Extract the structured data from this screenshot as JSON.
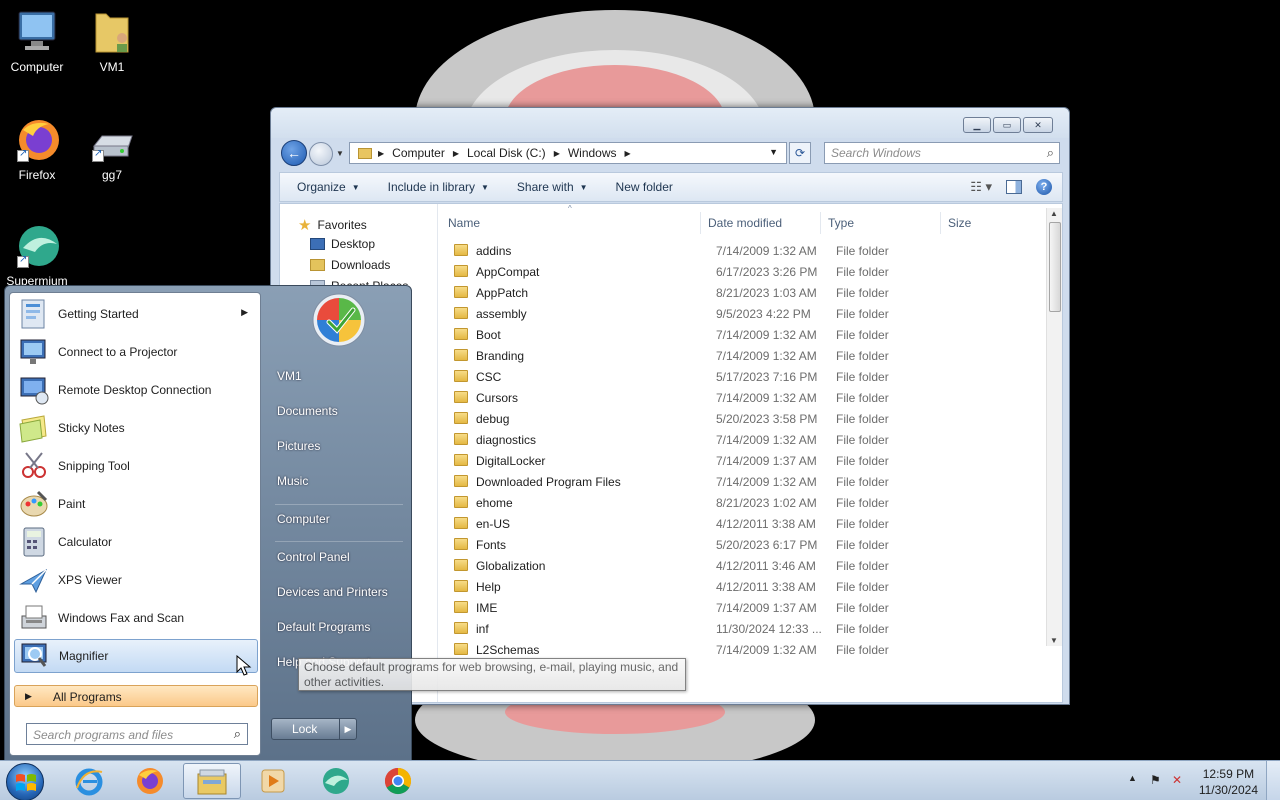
{
  "desktop": {
    "icons": [
      {
        "label": "Computer"
      },
      {
        "label": "VM1"
      },
      {
        "label": "Firefox"
      },
      {
        "label": "gg7"
      },
      {
        "label": "Supermium"
      }
    ]
  },
  "explorer": {
    "breadcrumb": [
      "Computer",
      "Local Disk (C:)",
      "Windows"
    ],
    "search_placeholder": "Search Windows",
    "toolbar": {
      "organize": "Organize",
      "include_in_library": "Include in library",
      "share_with": "Share with",
      "new_folder": "New folder"
    },
    "nav_pane": {
      "favorites": "Favorites",
      "items": [
        "Desktop",
        "Downloads",
        "Recent Places"
      ]
    },
    "columns": {
      "name": "Name",
      "date_modified": "Date modified",
      "type": "Type",
      "size": "Size"
    },
    "files": [
      {
        "name": "addins",
        "date": "7/14/2009 1:32 AM",
        "type": "File folder"
      },
      {
        "name": "AppCompat",
        "date": "6/17/2023 3:26 PM",
        "type": "File folder"
      },
      {
        "name": "AppPatch",
        "date": "8/21/2023 1:03 AM",
        "type": "File folder"
      },
      {
        "name": "assembly",
        "date": "9/5/2023 4:22 PM",
        "type": "File folder"
      },
      {
        "name": "Boot",
        "date": "7/14/2009 1:32 AM",
        "type": "File folder"
      },
      {
        "name": "Branding",
        "date": "7/14/2009 1:32 AM",
        "type": "File folder"
      },
      {
        "name": "CSC",
        "date": "5/17/2023 7:16 PM",
        "type": "File folder"
      },
      {
        "name": "Cursors",
        "date": "7/14/2009 1:32 AM",
        "type": "File folder"
      },
      {
        "name": "debug",
        "date": "5/20/2023 3:58 PM",
        "type": "File folder"
      },
      {
        "name": "diagnostics",
        "date": "7/14/2009 1:32 AM",
        "type": "File folder"
      },
      {
        "name": "DigitalLocker",
        "date": "7/14/2009 1:37 AM",
        "type": "File folder"
      },
      {
        "name": "Downloaded Program Files",
        "date": "7/14/2009 1:32 AM",
        "type": "File folder"
      },
      {
        "name": "ehome",
        "date": "8/21/2023 1:02 AM",
        "type": "File folder"
      },
      {
        "name": "en-US",
        "date": "4/12/2011 3:38 AM",
        "type": "File folder"
      },
      {
        "name": "Fonts",
        "date": "5/20/2023 6:17 PM",
        "type": "File folder"
      },
      {
        "name": "Globalization",
        "date": "4/12/2011 3:46 AM",
        "type": "File folder"
      },
      {
        "name": "Help",
        "date": "4/12/2011 3:38 AM",
        "type": "File folder"
      },
      {
        "name": "IME",
        "date": "7/14/2009 1:37 AM",
        "type": "File folder"
      },
      {
        "name": "inf",
        "date": "11/30/2024 12:33 ...",
        "type": "File folder"
      },
      {
        "name": "L2Schemas",
        "date": "7/14/2009 1:32 AM",
        "type": "File folder"
      }
    ]
  },
  "start_menu": {
    "programs": [
      {
        "label": "Getting Started",
        "icon": "getting-started-icon",
        "has_submenu": true
      },
      {
        "label": "Connect to a Projector",
        "icon": "projector-icon"
      },
      {
        "label": "Remote Desktop Connection",
        "icon": "remote-desktop-icon"
      },
      {
        "label": "Sticky Notes",
        "icon": "sticky-notes-icon"
      },
      {
        "label": "Snipping Tool",
        "icon": "snipping-tool-icon"
      },
      {
        "label": "Paint",
        "icon": "paint-icon"
      },
      {
        "label": "Calculator",
        "icon": "calculator-icon"
      },
      {
        "label": "XPS Viewer",
        "icon": "xps-viewer-icon"
      },
      {
        "label": "Windows Fax and Scan",
        "icon": "fax-scan-icon"
      },
      {
        "label": "Magnifier",
        "icon": "magnifier-icon",
        "selected": true
      }
    ],
    "all_programs": "All Programs",
    "search_placeholder": "Search programs and files",
    "right_items": [
      "VM1",
      "Documents",
      "Pictures",
      "Music",
      "Computer",
      "Control Panel",
      "Devices and Printers",
      "Default Programs",
      "Help and Support"
    ],
    "lock_label": "Lock",
    "tooltip": "Choose default programs for web browsing, e-mail, playing music, and other activities."
  },
  "taskbar": {
    "apps": [
      "internet-explorer-icon",
      "firefox-icon",
      "file-explorer-icon",
      "media-player-icon",
      "supermium-icon",
      "chrome-icon"
    ],
    "active_app": "file-explorer-icon",
    "clock_time": "12:59 PM",
    "clock_date": "11/30/2024"
  }
}
